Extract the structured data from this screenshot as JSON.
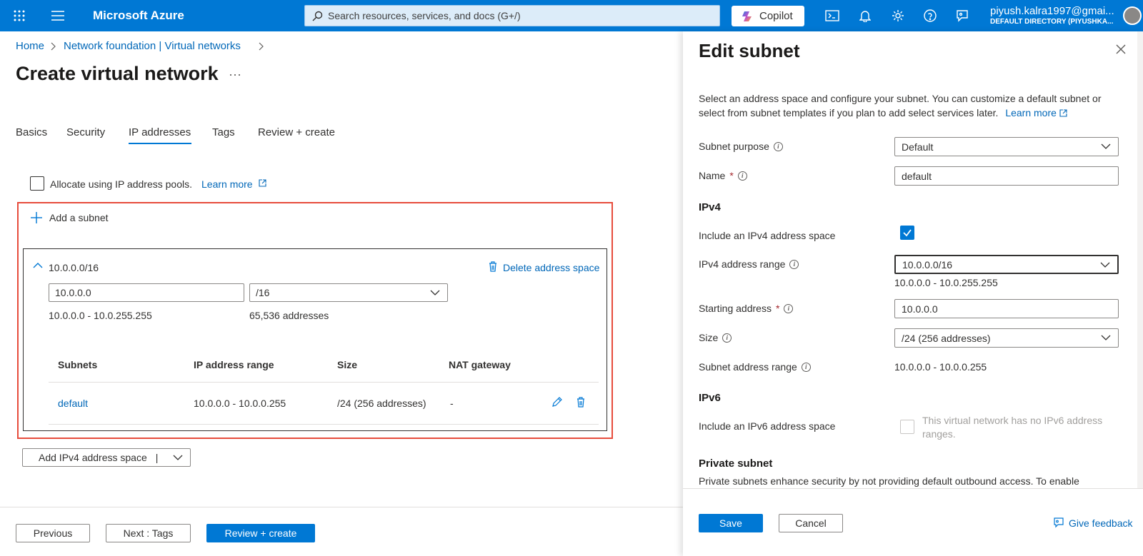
{
  "topbar": {
    "brand": "Microsoft Azure",
    "search_placeholder": "Search resources, services, and docs (G+/)",
    "copilot_label": "Copilot",
    "user_email": "piyush.kalra1997@gmai...",
    "user_directory": "DEFAULT DIRECTORY (PIYUSHKA..."
  },
  "breadcrumb": {
    "home": "Home",
    "parent": "Network foundation | Virtual networks"
  },
  "page": {
    "title": "Create virtual network",
    "more": "···"
  },
  "tabs": {
    "basics": "Basics",
    "security": "Security",
    "ip_addresses": "IP addresses",
    "tags": "Tags",
    "review_create": "Review + create",
    "active": "IP addresses"
  },
  "pools": {
    "label": "Allocate using IP address pools.",
    "learn_more": "Learn more"
  },
  "address_space": {
    "add_subnet": "Add a subnet",
    "cidr": "10.0.0.0/16",
    "delete_label": "Delete address space",
    "address_value": "10.0.0.0",
    "prefix_value": "/16",
    "range": "10.0.0.0 - 10.0.255.255",
    "count": "65,536 addresses",
    "columns": {
      "subnets": "Subnets",
      "range": "IP address range",
      "size": "Size",
      "nat": "NAT gateway"
    },
    "row": {
      "name": "default",
      "range": "10.0.0.0 - 10.0.0.255",
      "size": "/24 (256 addresses)",
      "nat": "-"
    }
  },
  "add_ipv4": {
    "label": "Add IPv4 address space",
    "sep": "|"
  },
  "footer": {
    "previous": "Previous",
    "next": "Next : Tags",
    "review": "Review + create"
  },
  "panel": {
    "title": "Edit subnet",
    "description": "Select an address space and configure your subnet. You can customize a default subnet or select from subnet templates if you plan to add select services later.",
    "learn_more": "Learn more",
    "subnet_purpose_label": "Subnet purpose",
    "subnet_purpose_value": "Default",
    "name_label": "Name",
    "required_mark": "*",
    "name_value": "default",
    "ipv4_heading": "IPv4",
    "include_ipv4_label": "Include an IPv4 address space",
    "ipv4_range_label": "IPv4 address range",
    "ipv4_range_value": "10.0.0.0/16",
    "ipv4_range_text": "10.0.0.0 - 10.0.255.255",
    "starting_label": "Starting address",
    "starting_value": "10.0.0.0",
    "size_label": "Size",
    "size_value": "/24 (256 addresses)",
    "subnet_range_label": "Subnet address range",
    "subnet_range_value": "10.0.0.0 - 10.0.0.255",
    "ipv6_heading": "IPv6",
    "include_ipv6_label": "Include an IPv6 address space",
    "ipv6_note": "This virtual network has no IPv6 address ranges.",
    "private_heading": "Private subnet",
    "private_desc": "Private subnets enhance security by not providing default outbound access. To enable",
    "save": "Save",
    "cancel": "Cancel",
    "feedback": "Give feedback"
  },
  "colors": {
    "brand": "#0078d4",
    "link": "#0067b8",
    "highlight": "#e74c3c"
  }
}
